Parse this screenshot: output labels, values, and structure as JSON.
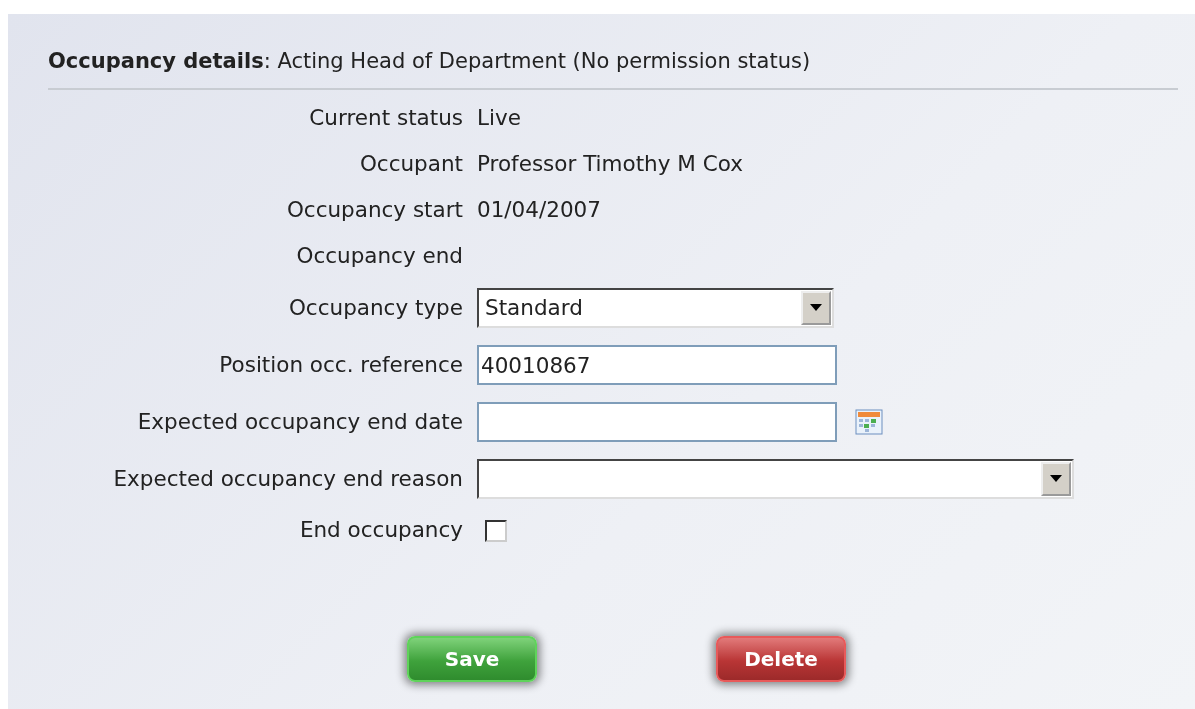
{
  "header": {
    "title": "Occupancy details",
    "subtitle": ": Acting Head of Department (No permission status)"
  },
  "fields": [
    {
      "kind": "text",
      "label": "Current status",
      "value": "Live"
    },
    {
      "kind": "text",
      "label": "Occupant",
      "value": "Professor Timothy M Cox"
    },
    {
      "kind": "text",
      "label": "Occupancy start",
      "value": "01/04/2007"
    },
    {
      "kind": "text",
      "label": "Occupancy end"
    },
    {
      "kind": "select",
      "label": "Occupancy type",
      "value": "Standard"
    },
    {
      "kind": "input",
      "label": "Position occ. reference",
      "value": "40010867"
    },
    {
      "kind": "date",
      "label": "Expected occupancy end date"
    },
    {
      "kind": "longselect",
      "label": "Expected occupancy end reason"
    },
    {
      "kind": "checkbox",
      "label": "End occupancy",
      "checked": false
    }
  ],
  "buttons": [
    {
      "label": "Save",
      "kind": "save"
    },
    {
      "label": "Delete",
      "kind": "delete"
    }
  ]
}
